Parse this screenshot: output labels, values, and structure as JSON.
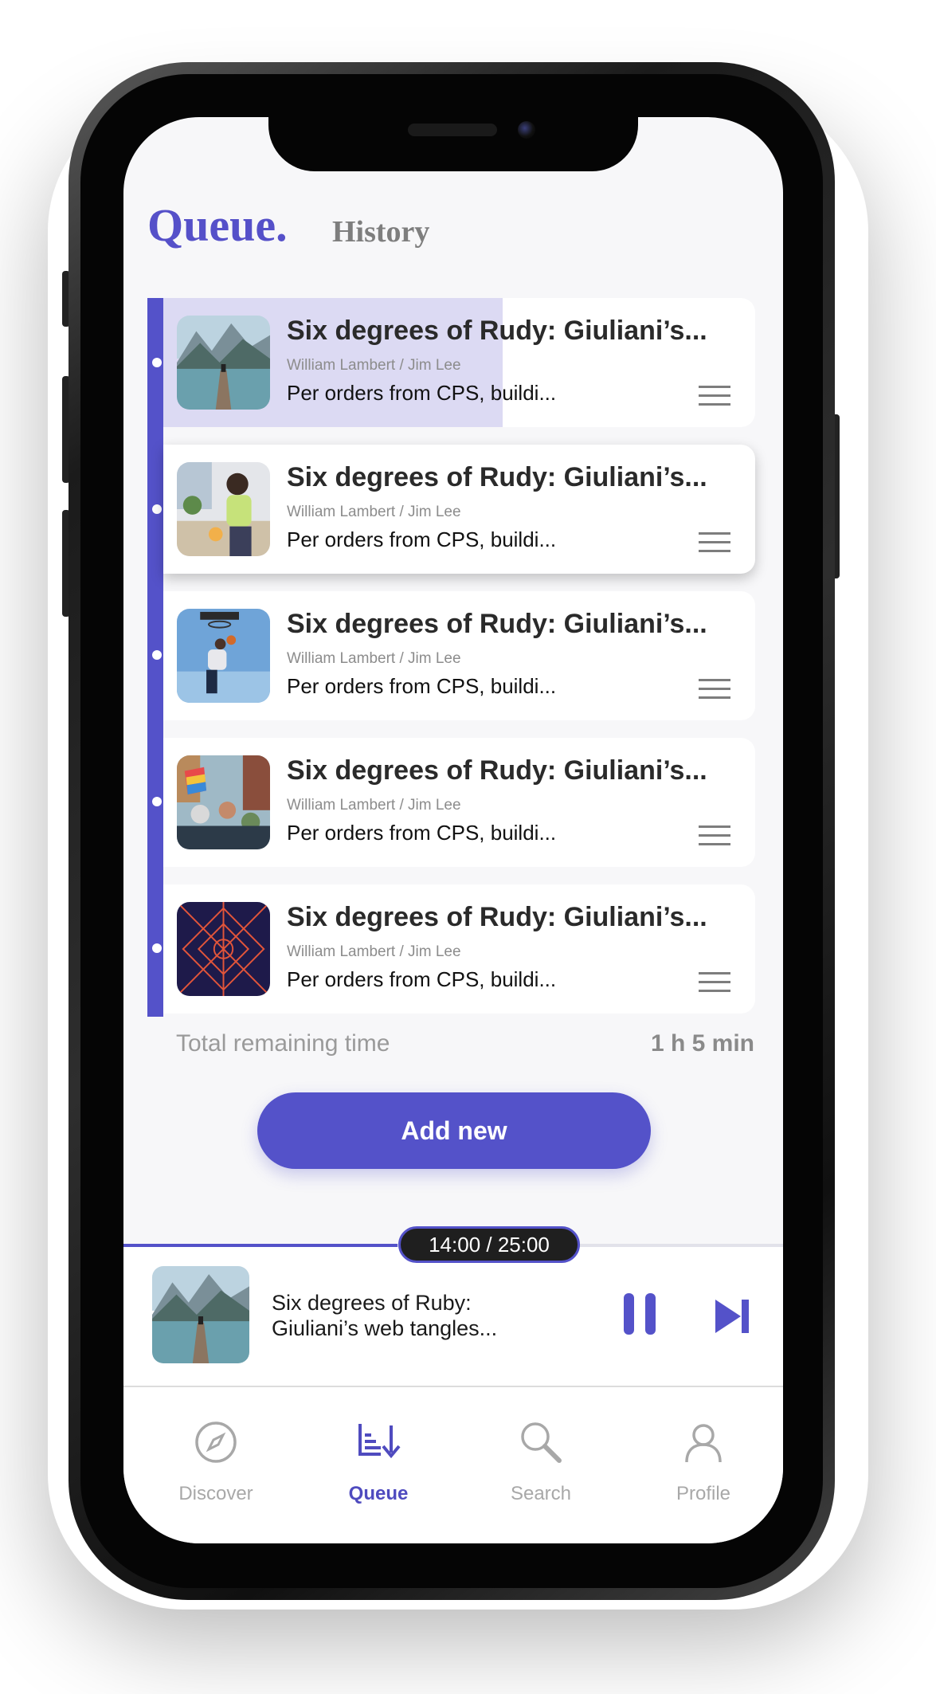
{
  "tabs": {
    "queue": "Queue.",
    "history": "History"
  },
  "queue": {
    "items": [
      {
        "title": "Six degrees of Rudy: Giuliani’s...",
        "authors": "William Lambert / Jim Lee",
        "description": "Per orders from CPS, buildi...",
        "image": "mountain-lake-dock"
      },
      {
        "title": "Six degrees of Rudy: Giuliani’s...",
        "authors": "William Lambert / Jim Lee",
        "description": "Per orders from CPS, buildi...",
        "image": "woman-in-kitchen"
      },
      {
        "title": "Six degrees of Rudy: Giuliani’s...",
        "authors": "William Lambert / Jim Lee",
        "description": "Per orders from CPS, buildi...",
        "image": "basketball-dunk"
      },
      {
        "title": "Six degrees of Rudy: Giuliani’s...",
        "authors": "William Lambert / Jim Lee",
        "description": "Per orders from CPS, buildi...",
        "image": "street-protest"
      },
      {
        "title": "Six degrees of Rudy: Giuliani’s...",
        "authors": "William Lambert / Jim Lee",
        "description": "Per orders from CPS, buildi...",
        "image": "geometric-pattern"
      }
    ],
    "first_item_progress": 0.57,
    "total_label": "Total remaining time",
    "total_value": "1 h 5 min",
    "add_button": "Add new"
  },
  "player": {
    "time": "14:00 / 25:00",
    "progress": 0.56,
    "title": "Six degrees of Ruby: Giuliani’s web tangles...",
    "pause_icon": "pause-icon",
    "next_icon": "skip-next-icon"
  },
  "nav": {
    "items": [
      {
        "label": "Discover",
        "icon": "compass-icon",
        "active": false
      },
      {
        "label": "Queue",
        "icon": "queue-sort-icon",
        "active": true
      },
      {
        "label": "Search",
        "icon": "search-icon",
        "active": false
      },
      {
        "label": "Profile",
        "icon": "profile-icon",
        "active": false
      }
    ]
  },
  "colors": {
    "accent": "#5452c9",
    "background": "#f7f7f9",
    "progress_highlight": "#dcdaf3"
  }
}
